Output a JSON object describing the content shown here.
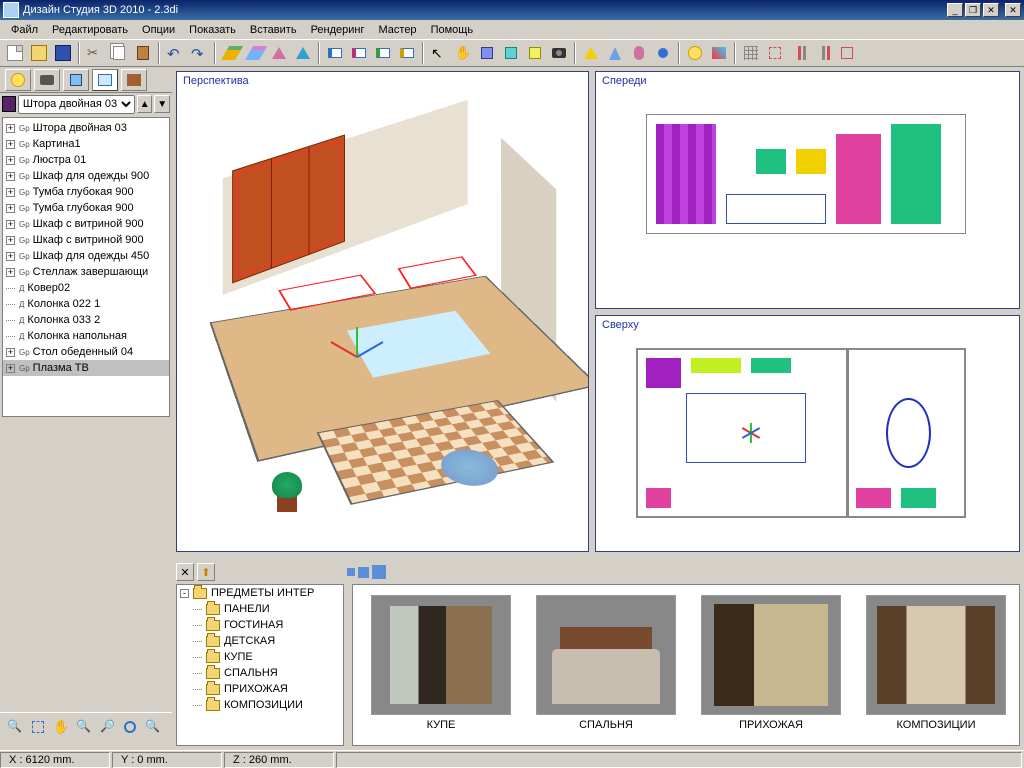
{
  "window": {
    "title": "Дизайн Студия 3D 2010 - 2.3di"
  },
  "menu": [
    "Файл",
    "Редактировать",
    "Опции",
    "Показать",
    "Вставить",
    "Рендеринг",
    "Мастер",
    "Помощь"
  ],
  "object_combo": {
    "value": "Штора двойная 03"
  },
  "scene_tree": [
    {
      "exp": "+",
      "kind": "Gp",
      "label": "Штора двойная 03"
    },
    {
      "exp": "+",
      "kind": "Gp",
      "label": "Картина1"
    },
    {
      "exp": "+",
      "kind": "Gp",
      "label": "Люстра 01"
    },
    {
      "exp": "+",
      "kind": "Gp",
      "label": "Шкаф для одежды 900"
    },
    {
      "exp": "+",
      "kind": "Gp",
      "label": "Тумба глубокая 900"
    },
    {
      "exp": "+",
      "kind": "Gp",
      "label": "Тумба глубокая 900"
    },
    {
      "exp": "+",
      "kind": "Gp",
      "label": "Шкаф с витриной 900"
    },
    {
      "exp": "+",
      "kind": "Gp",
      "label": "Шкаф с витриной 900"
    },
    {
      "exp": "+",
      "kind": "Gp",
      "label": "Шкаф для одежды 450"
    },
    {
      "exp": "+",
      "kind": "Gp",
      "label": "Стеллаж завершающи"
    },
    {
      "exp": "",
      "kind": "Д",
      "label": "Ковер02"
    },
    {
      "exp": "",
      "kind": "Д",
      "label": "Колонка 022 1"
    },
    {
      "exp": "",
      "kind": "Д",
      "label": "Колонка 033 2"
    },
    {
      "exp": "",
      "kind": "Д",
      "label": "Колонка напольная"
    },
    {
      "exp": "+",
      "kind": "Gp",
      "label": "Стол обеденный 04"
    },
    {
      "exp": "+",
      "kind": "Gp",
      "label": "Плазма ТВ",
      "sel": true
    }
  ],
  "viewports": {
    "perspective": "Перспектива",
    "front": "Спереди",
    "top": "Сверху"
  },
  "library_tree": [
    "ПРЕДМЕТЫ ИНТЕР",
    "ПАНЕЛИ",
    "ГОСТИНАЯ",
    "ДЕТСКАЯ",
    "КУПЕ",
    "СПАЛЬНЯ",
    "ПРИХОЖАЯ",
    "КОМПОЗИЦИИ"
  ],
  "library_tiles": [
    {
      "label": "КУПЕ",
      "cls": "th-kupe"
    },
    {
      "label": "СПАЛЬНЯ",
      "cls": "th-bed"
    },
    {
      "label": "ПРИХОЖАЯ",
      "cls": "th-hall"
    },
    {
      "label": "КОМПОЗИЦИИ",
      "cls": "th-comp"
    }
  ],
  "status": {
    "x": "X : 6120 mm.",
    "y": "Y : 0 mm.",
    "z": "Z : 260 mm."
  }
}
